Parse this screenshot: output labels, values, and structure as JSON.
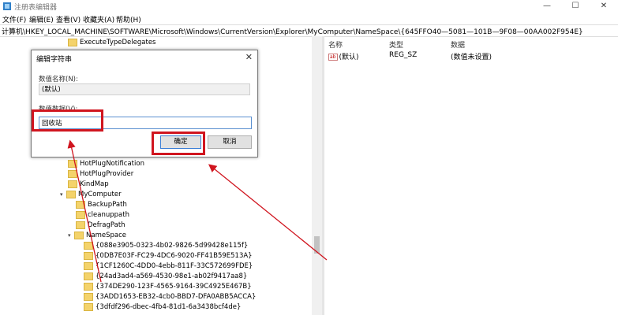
{
  "window": {
    "title": "注册表编辑器",
    "min_glyph": "—",
    "max_glyph": "☐",
    "close_glyph": "✕"
  },
  "menu": [
    "文件(F)",
    "编辑(E)",
    "查看(V)",
    "收藏夹(A)",
    "帮助(H)"
  ],
  "address": "计算机\\HKEY_LOCAL_MACHINE\\SOFTWARE\\Microsoft\\Windows\\CurrentVersion\\Explorer\\MyComputer\\NameSpace\\{645FFO40—5081—101B—9F08—00AA002F954E}",
  "tree": {
    "top_item": "ExecuteTypeDelegates",
    "items": [
      "HotPlugNotification",
      "HotPlugProvider",
      "KindMap",
      "MyComputer",
      "BackupPath",
      "cleanuppath",
      "DefragPath",
      "NameSpace"
    ],
    "guids": [
      "{088e3905-0323-4b02-9826-5d99428e115f}",
      "{0DB7E03F-FC29-4DC6-9020-FF41B59E513A}",
      "{1CF1260C-4DD0-4ebb-811F-33C572699FDE}",
      "{24ad3ad4-a569-4530-98e1-ab02f9417aa8}",
      "{374DE290-123F-4565-9164-39C4925E467B}",
      "{3ADD1653-EB32-4cb0-BBD7-DFA0ABB5ACCA}",
      "{3dfdf296-dbec-4fb4-81d1-6a3438bcf4de}"
    ]
  },
  "list": {
    "headers": [
      "名称",
      "类型",
      "数据"
    ],
    "row": {
      "name": "(默认)",
      "type": "REG_SZ",
      "data": "(数值未设置)",
      "icon": "ab-icon"
    }
  },
  "dialog": {
    "title": "编辑字符串",
    "close_glyph": "✕",
    "name_label": "数值名称(N):",
    "name_value": "(默认)",
    "data_label": "数值数据(V):",
    "data_value": "回收站",
    "ok_label": "确定",
    "cancel_label": "取消"
  },
  "annotation_color": "#d0151f"
}
